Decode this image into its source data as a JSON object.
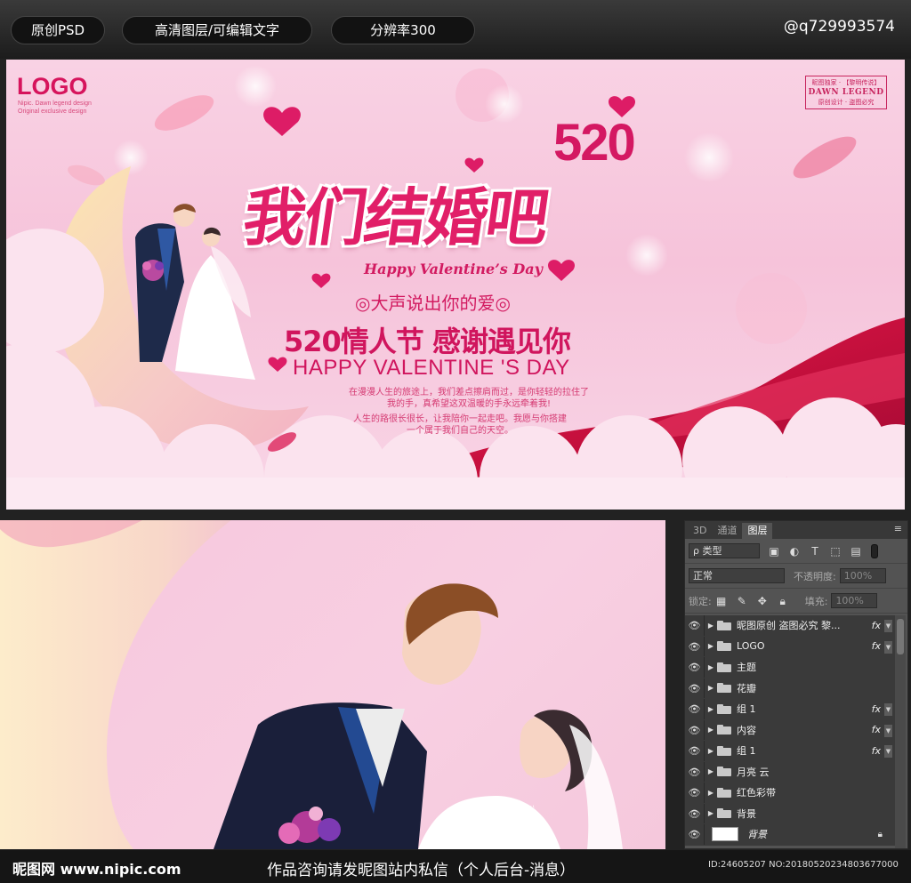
{
  "top_bar": {
    "pills": [
      "原创PSD",
      "高清图层/可编辑文字",
      "分辨率300"
    ],
    "handle": "@q729993574"
  },
  "banner": {
    "logo": "LOGO",
    "logo_sub_1": "Nipic. Dawn legend design",
    "logo_sub_2": "Original exclusive design",
    "stamp_top": "昵图独家 · 【黎明传说】",
    "stamp_mid": "DAWN LEGEND",
    "stamp_bottom": "原创设计 · 盗图必究",
    "number": "520",
    "title": "我们结婚吧",
    "script": "Happy Valentine’s Day",
    "shout": "◎大声说出你的爱◎",
    "headline": "520情人节 感谢遇见你",
    "caps": "HAPPY VALENTINE 'S DAY",
    "para1_line1": "在漫漫人生的旅途上，我们差点擦肩而过，是你轻轻的拉住了",
    "para1_line2": "我的手，真希望这双温暖的手永远牵着我!",
    "para2_line1": "人生的路很长很长，让我陪你一起走吧。我愿与你搭建",
    "para2_line2": "一个属于我们自己的天空。"
  },
  "layers_panel": {
    "tabs": [
      "3D",
      "通道",
      "图层"
    ],
    "active_tab": "图层",
    "menu_icon": "≡",
    "kind_filter": "ρ 类型",
    "blend_mode": "正常",
    "opacity_label": "不透明度:",
    "opacity_value": "100%",
    "lock_label": "锁定:",
    "fill_label": "填充:",
    "fill_value": "100%",
    "layers": [
      {
        "name": "昵图原创 盗图必究 黎...",
        "fx": "fx",
        "type": "group"
      },
      {
        "name": "LOGO",
        "fx": "fx",
        "type": "group"
      },
      {
        "name": "主题",
        "fx": "",
        "type": "group"
      },
      {
        "name": "花瓣",
        "fx": "",
        "type": "group"
      },
      {
        "name": "组 1",
        "fx": "fx",
        "type": "group"
      },
      {
        "name": "内容",
        "fx": "fx",
        "type": "group"
      },
      {
        "name": "组 1",
        "fx": "fx",
        "type": "group"
      },
      {
        "name": "月亮 云",
        "fx": "",
        "type": "group"
      },
      {
        "name": "红色彩带",
        "fx": "",
        "type": "group"
      },
      {
        "name": "背景",
        "fx": "",
        "type": "group"
      },
      {
        "name": "背景",
        "fx": "",
        "type": "background"
      }
    ]
  },
  "bottom_bar": {
    "site": "昵图网 www.nipic.com",
    "message": "作品咨询请发昵图站内私信（个人后台-消息）",
    "id": "ID:24605207 NO:20180520234803677000"
  },
  "colors": {
    "brand_pink": "#d0155d",
    "background_pink": "#f7c6dc",
    "ribbon_red": "#c8103e",
    "panel_gray": "#535353"
  }
}
